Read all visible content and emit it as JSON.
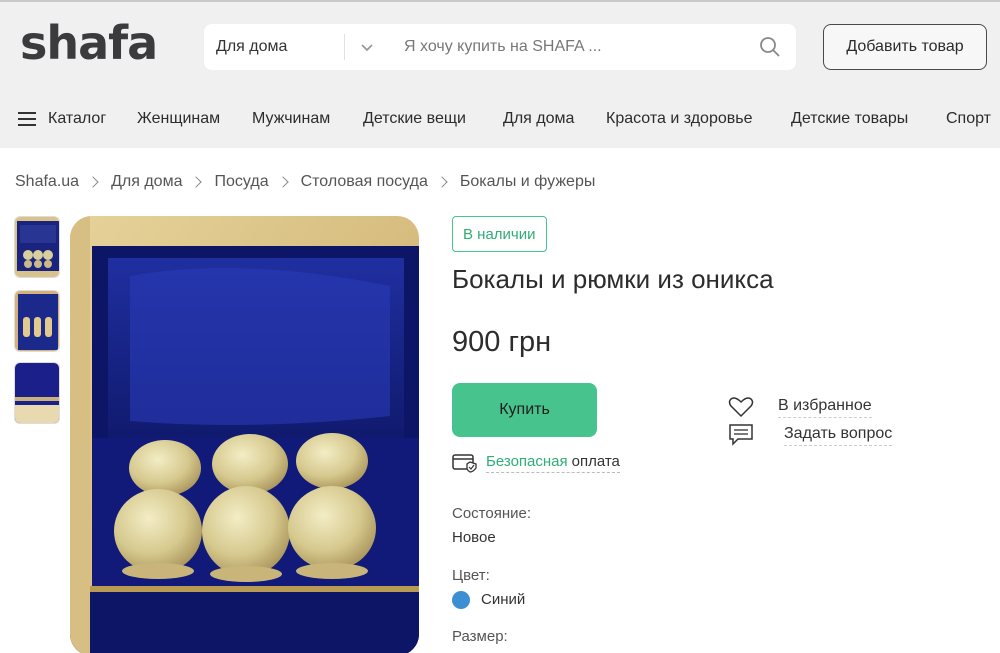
{
  "header": {
    "logo": "shafa",
    "category_select": "Для дома",
    "search_placeholder": "Я хочу купить на SHAFA ...",
    "add_button": "Добавить товар"
  },
  "nav": {
    "items": [
      "Каталог",
      "Женщинам",
      "Мужчинам",
      "Детские вещи",
      "Для дома",
      "Красота и здоровье",
      "Детские товары",
      "Спорт"
    ]
  },
  "breadcrumb": [
    "Shafa.ua",
    "Для дома",
    "Посуда",
    "Столовая посуда",
    "Бокалы и фужеры"
  ],
  "product": {
    "availability": "В наличии",
    "title": "Бокалы и рюмки из оникса",
    "price": "900 грн",
    "buy_button": "Купить",
    "safe_payment_link": "Безопасная",
    "safe_payment_rest": "оплата",
    "favorite": "В избранное",
    "ask_question": "Задать вопрос",
    "condition_label": "Состояние:",
    "condition_value": "Новое",
    "color_label": "Цвет:",
    "color_value": "Синий",
    "color_hex": "#3b8fd2",
    "size_label": "Размер:"
  },
  "colors": {
    "accent": "#47c38d",
    "accent_text": "#2fae76",
    "header_bg": "#f0f0f1"
  }
}
